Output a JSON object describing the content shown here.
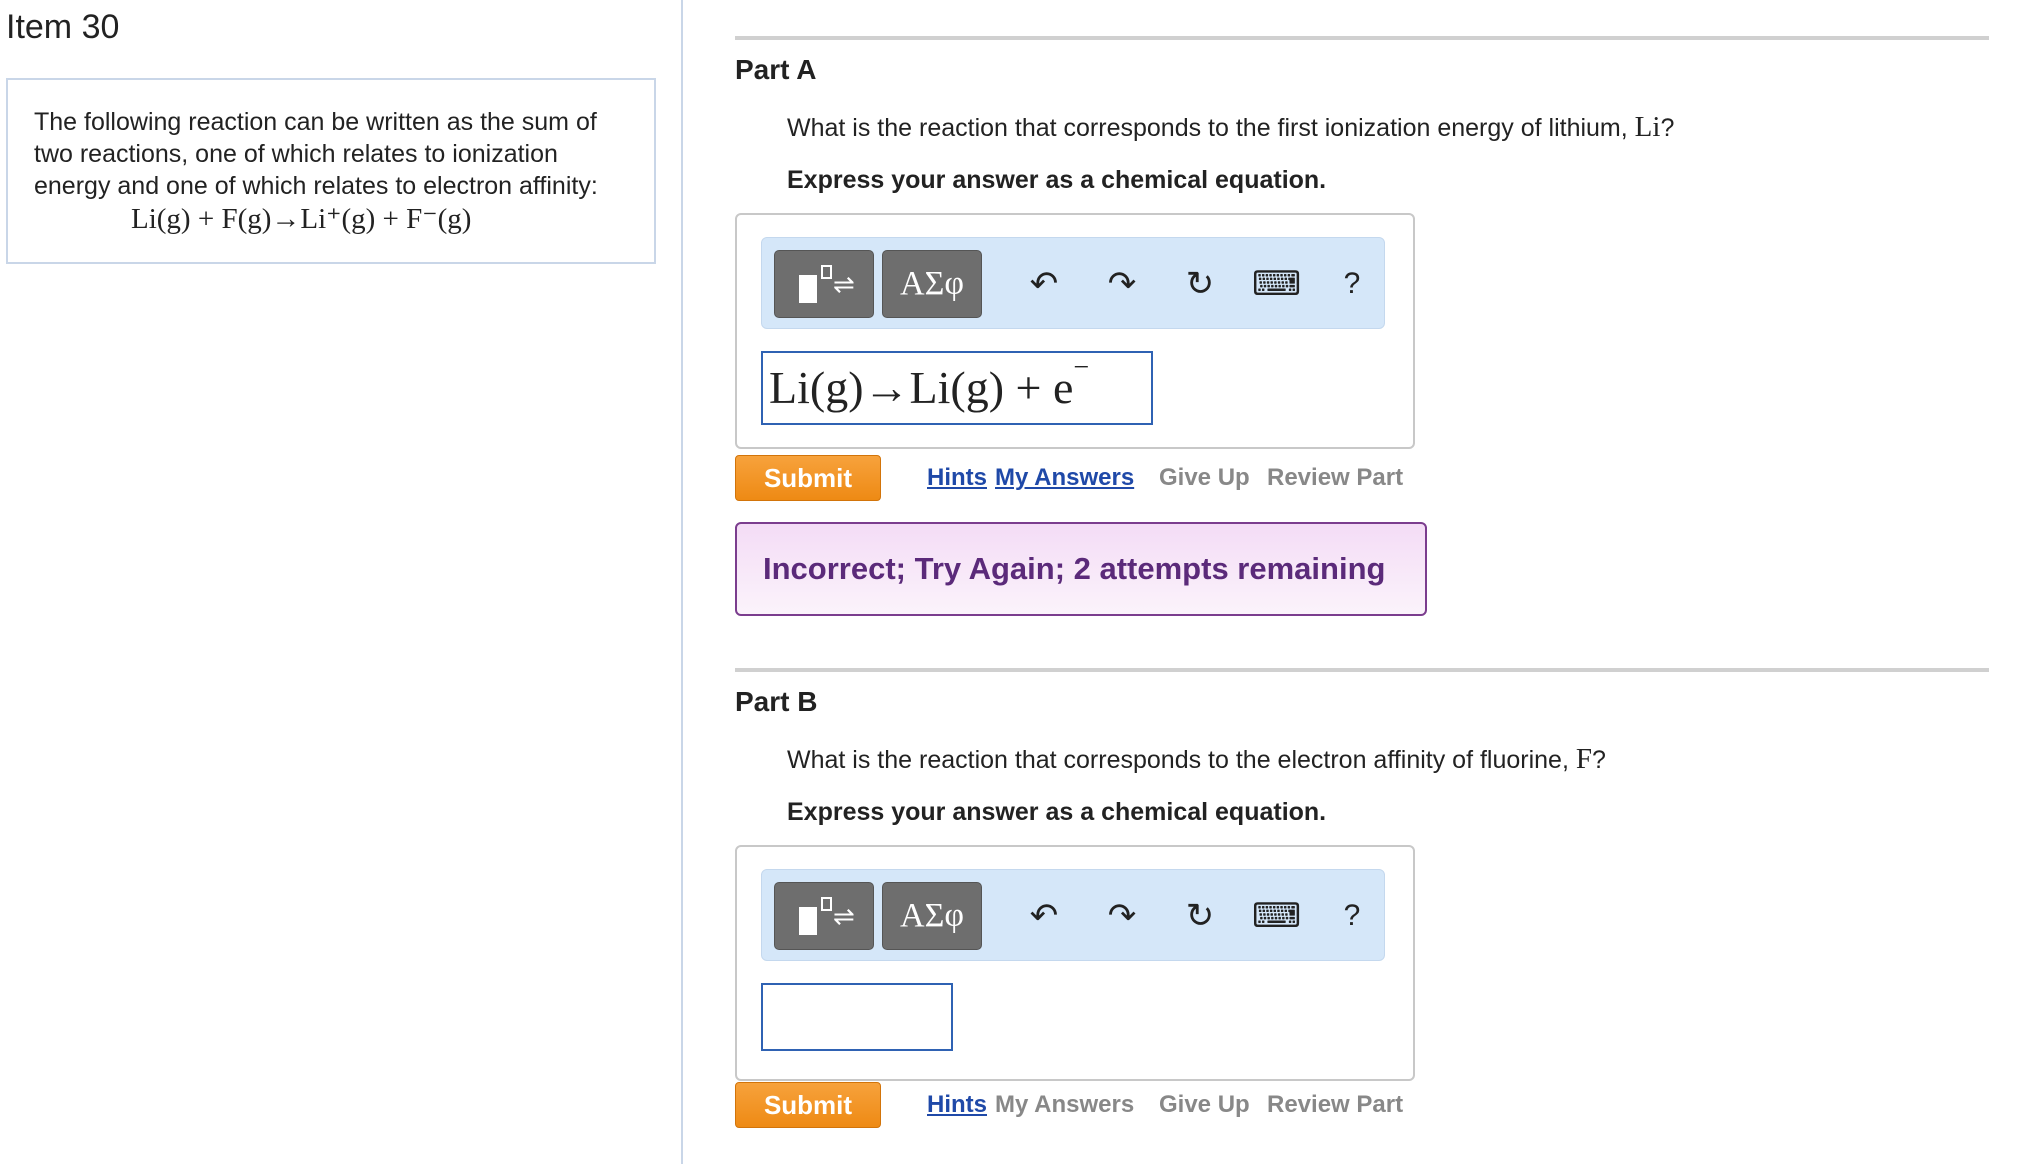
{
  "item": {
    "title": "Item 30",
    "stem_text": "The following reaction can be written as the sum of two reactions, one of which relates to ionization energy and one of which relates to electron affinity:",
    "stem_equation": "Li(g) + F(g)→Li⁺(g) + F⁻(g)"
  },
  "toolbar": {
    "template_icon": "template-icon",
    "greek_label": "ΑΣφ",
    "undo_glyph": "↶",
    "redo_glyph": "↷",
    "reset_glyph": "↻",
    "keyboard_glyph": "⌨",
    "help_label": "?"
  },
  "actions": {
    "submit": "Submit",
    "hints": "Hints",
    "my_answers": "My Answers",
    "give_up": "Give Up",
    "review_part": "Review Part"
  },
  "part_a": {
    "title": "Part A",
    "question": "What is the reaction that corresponds to the first ionization energy of lithium, ",
    "question_math": "Li",
    "question_end": "?",
    "instruction": "Express your answer as a chemical equation.",
    "answer_main": "Li(g)→Li(g) + e",
    "answer_sup": "−",
    "feedback": "Incorrect; Try Again; 2 attempts remaining"
  },
  "part_b": {
    "title": "Part B",
    "question": "What is the reaction that corresponds to the electron affinity of fluorine, ",
    "question_math": "F",
    "question_end": "?",
    "instruction": "Express your answer as a chemical equation.",
    "answer_main": ""
  },
  "colors": {
    "accent_orange": "#ee8a14",
    "link_blue": "#1f49a8",
    "feedback_purple": "#5b2a7a",
    "toolbar_bg": "#d5e7f9"
  }
}
